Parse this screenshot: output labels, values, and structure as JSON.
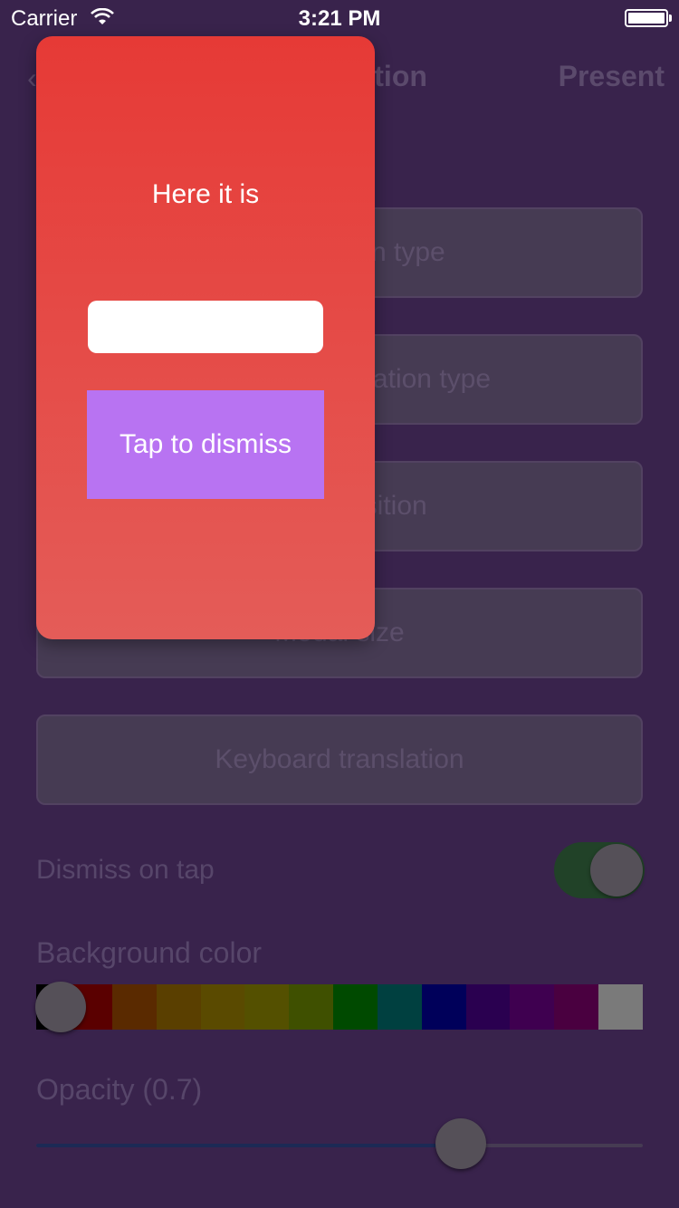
{
  "status_bar": {
    "carrier": "Carrier",
    "time": "3:21 PM"
  },
  "nav": {
    "back_icon": "chevron-left-icon",
    "back_glyph": "‹",
    "title": "Presentation",
    "present_label": "Present"
  },
  "settings": {
    "buttons": [
      {
        "label": "Presentation type"
      },
      {
        "label": "Transition animation type"
      },
      {
        "label": "Modal position"
      },
      {
        "label": "Modal size"
      },
      {
        "label": "Keyboard translation"
      }
    ],
    "dismiss_on_tap": {
      "label": "Dismiss on tap",
      "enabled": true
    },
    "background_color": {
      "label": "Background color",
      "swatches": [
        "#000000",
        "#5a0000",
        "#5a2a00",
        "#5a3f00",
        "#5a4a00",
        "#545000",
        "#3f5000",
        "#004a00",
        "#004040",
        "#00005a",
        "#2a0050",
        "#3f0050",
        "#4a0040",
        "#7a7a7a"
      ],
      "selected_index": 0
    },
    "opacity": {
      "label": "Opacity (0.7)",
      "value": 0.7
    }
  },
  "modal": {
    "title": "Here it is",
    "input_value": "",
    "dismiss_label": "Tap to dismiss",
    "colors": {
      "gradient_top": "#e63a36",
      "gradient_bottom": "#e45c58",
      "button": "#b873f2"
    }
  }
}
